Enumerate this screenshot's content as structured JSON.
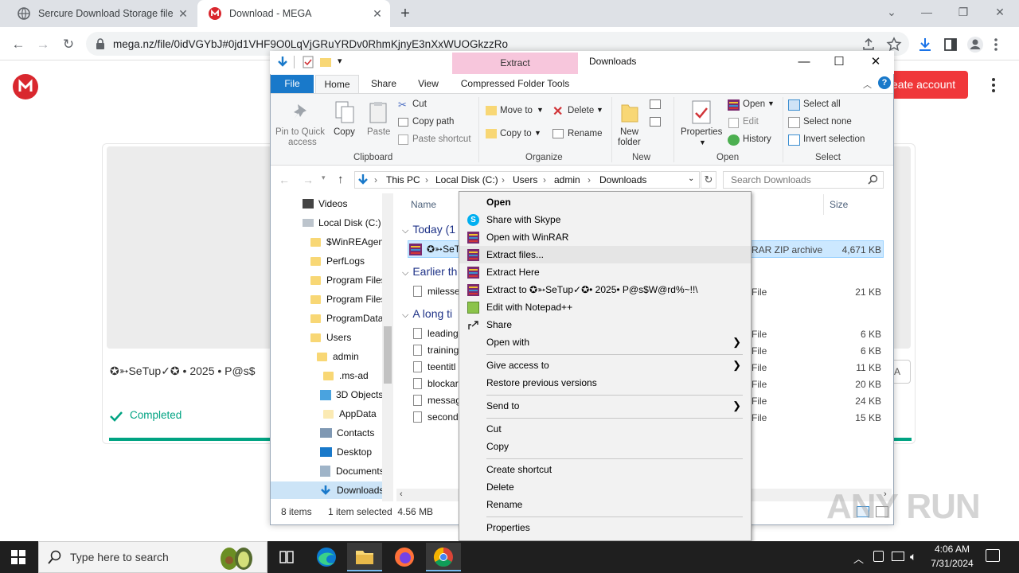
{
  "browser": {
    "tabs": [
      {
        "title": "Sercure Download Storage file"
      },
      {
        "title": "Download - MEGA"
      }
    ],
    "url": "mega.nz/file/0idVGYbJ#0jd1VHF9O0LqVjGRuYRDv0RhmKjnyE3nXxWUOGkzzRo"
  },
  "mega": {
    "create_account": "eate account",
    "filename": "✪➳SeTup✓✪ • 2025 • P@s$",
    "status": "Completed",
    "progress": 1.0,
    "right_btn": "A"
  },
  "explorer": {
    "title": "Downloads",
    "contextual_tab": "Extract",
    "tabs": [
      "File",
      "Home",
      "Share",
      "View",
      "Compressed Folder Tools"
    ],
    "ribbon": {
      "clipboard": {
        "pin": "Pin to Quick",
        "pin2": "access",
        "copy": "Copy",
        "paste": "Paste",
        "cut": "Cut",
        "copy_path": "Copy path",
        "paste_shortcut": "Paste shortcut",
        "group": "Clipboard"
      },
      "organize": {
        "move_to": "Move to",
        "copy_to": "Copy to",
        "delete": "Delete",
        "rename": "Rename",
        "group": "Organize"
      },
      "new": {
        "new_folder": "New",
        "new_folder2": "folder",
        "group": "New"
      },
      "open": {
        "properties": "Properties",
        "open": "Open",
        "edit": "Edit",
        "history": "History",
        "group": "Open"
      },
      "select": {
        "select_all": "Select all",
        "select_none": "Select none",
        "invert": "Invert selection",
        "group": "Select"
      }
    },
    "breadcrumb": [
      "This PC",
      "Local Disk (C:)",
      "Users",
      "admin",
      "Downloads"
    ],
    "search_placeholder": "Search Downloads",
    "nav": [
      "Videos",
      "Local Disk (C:)",
      "$WinREAgent",
      "PerfLogs",
      "Program Files",
      "Program Files",
      "ProgramData",
      "Users",
      "admin",
      ".ms-ad",
      "3D Objects",
      "AppData",
      "Contacts",
      "Desktop",
      "Documents",
      "Downloads"
    ],
    "columns": {
      "name": "Name",
      "size": "Size"
    },
    "sections": [
      "Today (1",
      "Earlier th",
      "A long ti"
    ],
    "files": [
      {
        "name": "✪➳SeT",
        "type": "RAR ZIP archive",
        "size": "4,671 KB"
      },
      {
        "name": "milesse",
        "type": "File",
        "size": "21 KB"
      },
      {
        "name": "leading",
        "type": "File",
        "size": "6 KB"
      },
      {
        "name": "training",
        "type": "File",
        "size": "6 KB"
      },
      {
        "name": "teentitl",
        "type": "File",
        "size": "11 KB"
      },
      {
        "name": "blockar",
        "type": "File",
        "size": "20 KB"
      },
      {
        "name": "messag",
        "type": "File",
        "size": "24 KB"
      },
      {
        "name": "seconde",
        "type": "File",
        "size": "15 KB"
      }
    ],
    "status": {
      "items": "8 items",
      "selected": "1 item selected  4.56 MB"
    }
  },
  "context_menu": [
    {
      "label": "Open",
      "icon": "none",
      "bold": true
    },
    {
      "label": "Share with Skype",
      "icon": "skype-icon"
    },
    {
      "label": "Open with WinRAR",
      "icon": "winrar-icon"
    },
    {
      "label": "Extract files...",
      "icon": "winrar-icon"
    },
    {
      "label": "Extract Here",
      "icon": "winrar-icon"
    },
    {
      "label": "Extract to ✪➳SeTup✓✪• 2025• P@s$W@rd%~!!\\",
      "icon": "winrar-icon"
    },
    {
      "label": "Edit with Notepad++",
      "icon": "notepad-icon"
    },
    {
      "label": "Share",
      "icon": "share-icon"
    },
    {
      "label": "Open with",
      "submenu": true
    },
    {
      "label": "Give access to",
      "submenu": true
    },
    {
      "label": "Restore previous versions"
    },
    {
      "label": "Send to",
      "submenu": true
    },
    {
      "label": "Cut"
    },
    {
      "label": "Copy"
    },
    {
      "label": "Create shortcut"
    },
    {
      "label": "Delete"
    },
    {
      "label": "Rename"
    },
    {
      "label": "Properties"
    }
  ],
  "taskbar": {
    "search_placeholder": "Type here to search",
    "time": "4:06 AM",
    "date": "7/31/2024"
  },
  "watermark": "ANY RUN",
  "colors": {
    "mega_red": "#d9272e",
    "mega_green": "#00a382",
    "file_tab_blue": "#1979ca",
    "extract_pink": "#f7c6dc"
  }
}
